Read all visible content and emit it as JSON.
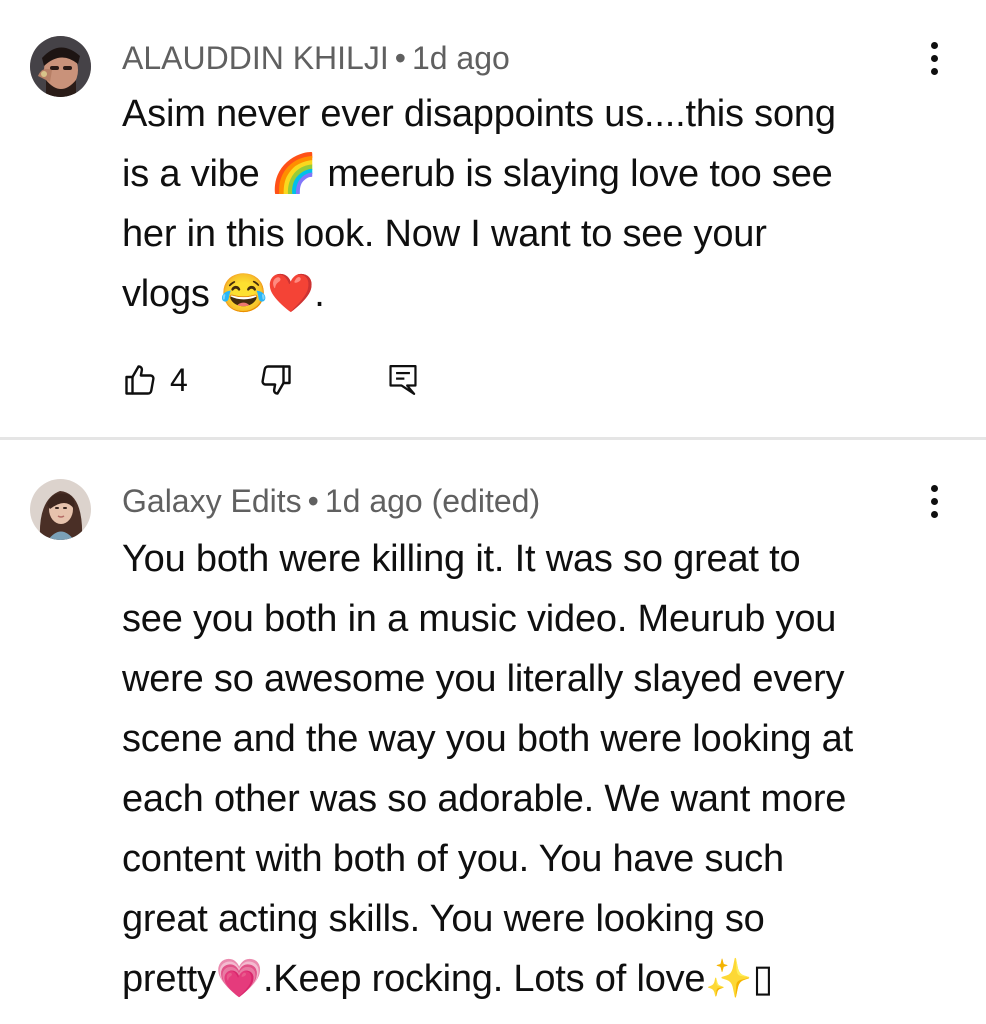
{
  "comments": [
    {
      "author": "ALAUDDIN KHILJI",
      "separator": "•",
      "time": "1d ago",
      "text_lines": [
        "Asim never ever disappoints us....this song",
        "is a vibe 🌈 meerub is slaying love too see",
        "her in this look. Now I want to see your",
        "vlogs 😂❤️."
      ],
      "likes": "4",
      "avatar_icon": "man-avatar-icon"
    },
    {
      "author": "Galaxy Edits",
      "separator": "•",
      "time": "1d ago (edited)",
      "text_lines": [
        "You both were killing it. It was so great to",
        "see you both in a music video. Meurub you",
        "were so awesome you literally slayed every",
        "scene and the way you both were looking at",
        "each other was so adorable. We want more",
        "content with both of you. You have such",
        "great acting skills. You were looking so",
        "pretty💗.Keep rocking. Lots of love✨▯"
      ],
      "avatar_icon": "woman-avatar-icon"
    }
  ],
  "icons": {
    "like": "thumbs-up-icon",
    "dislike": "thumbs-down-icon",
    "reply": "reply-icon",
    "more": "more-vertical-icon"
  },
  "colors": {
    "text": "#0f0f0f",
    "meta": "#606060",
    "divider": "#e5e5e5"
  }
}
